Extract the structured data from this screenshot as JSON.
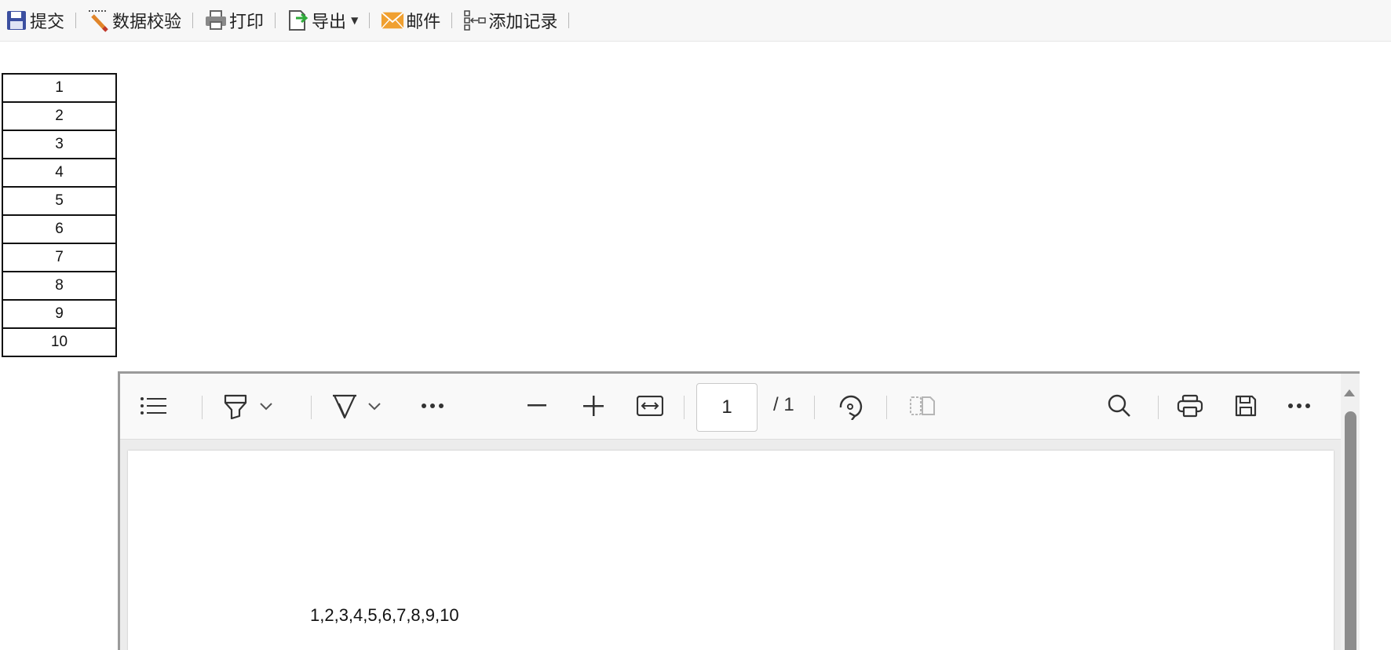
{
  "toolbar": {
    "submit_label": "提交",
    "validate_label": "数据校验",
    "print_label": "打印",
    "export_label": "导出",
    "mail_label": "邮件",
    "add_record_label": "添加记录"
  },
  "grid": {
    "rows": [
      "1",
      "2",
      "3",
      "4",
      "5",
      "6",
      "7",
      "8",
      "9",
      "10"
    ]
  },
  "pdf": {
    "current_page": "1",
    "page_total": "/ 1",
    "page_text": "1,2,3,4,5,6,7,8,9,10"
  },
  "icons": {
    "submit": "save-icon",
    "validate": "pencil-check-icon",
    "print": "printer-icon",
    "export": "export-icon",
    "mail": "envelope-icon",
    "add_record": "add-record-icon"
  },
  "colors": {
    "submit_icon": "#3b4fa0",
    "mail_icon": "#f0a030",
    "export_arrow": "#2eaa3a"
  }
}
